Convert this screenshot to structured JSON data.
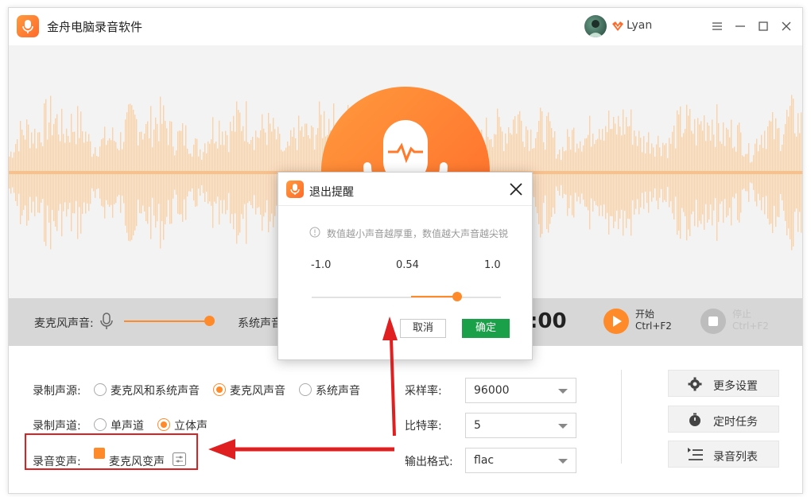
{
  "app": {
    "title": "金舟电脑录音软件",
    "username": "Lyan"
  },
  "control": {
    "mic_volume_label": "麦克风声音:",
    "system_volume_label": "系统声音",
    "timer": ":00",
    "start_label": "开始",
    "start_shortcut": "Ctrl+F2",
    "stop_label": "停止",
    "stop_shortcut": "Ctrl+F2",
    "mic_volume_level": 1.0
  },
  "settings": {
    "source_label": "录制声源:",
    "source_options": [
      "麦克风和系统声音",
      "麦克风声音",
      "系统声音"
    ],
    "source_selected": "麦克风声音",
    "channel_label": "录制声道:",
    "channel_options": [
      "单声道",
      "立体声"
    ],
    "channel_selected": "立体声",
    "voice_change_label": "录音变声:",
    "voice_change_option": "麦克风变声",
    "voice_change_checked": true,
    "sample_rate_label": "采样率:",
    "sample_rate_value": "96000",
    "bitrate_label": "比特率:",
    "bitrate_value": "5",
    "format_label": "输出格式:",
    "format_value": "flac"
  },
  "side_buttons": {
    "more_settings": "更多设置",
    "scheduled_task": "定时任务",
    "record_list": "录音列表"
  },
  "dialog": {
    "title": "退出提醒",
    "hint": "数值越小声音越厚重，数值越大声音越尖锐",
    "min_label": "-1.0",
    "current_label": "0.54",
    "max_label": "1.0",
    "slider_value": 0.54,
    "cancel_label": "取消",
    "ok_label": "确定"
  },
  "colors": {
    "accent": "#ff8a2a",
    "confirm": "#1aa049",
    "annotation": "#e02020",
    "wave": "#fbd1a8"
  },
  "icons": [
    "app-logo-icon",
    "vip-badge-icon",
    "menu-icon",
    "minimize-icon",
    "maximize-icon",
    "close-icon",
    "microphone-icon",
    "play-icon",
    "stop-icon",
    "gear-icon",
    "timer-icon",
    "list-icon",
    "equalizer-icon",
    "info-icon"
  ]
}
